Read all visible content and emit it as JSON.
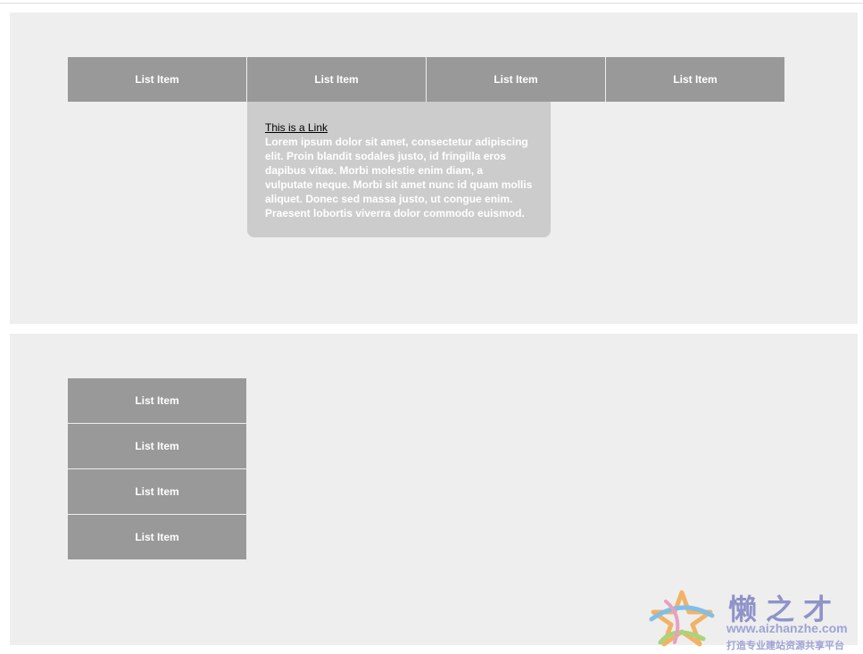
{
  "horizontal_menu": {
    "items": [
      {
        "label": "List Item"
      },
      {
        "label": "List Item"
      },
      {
        "label": "List Item"
      },
      {
        "label": "List Item"
      }
    ],
    "dropdown": {
      "link_text": "This is a Link",
      "body_text": "Lorem ipsum dolor sit amet, consectetur adipiscing elit. Proin blandit sodales justo, id fringilla eros dapibus vitae. Morbi molestie enim diam, a vulputate neque. Morbi sit amet nunc id quam mollis aliquet. Donec sed massa justo, ut congue enim. Praesent lobortis viverra dolor commodo euismod."
    }
  },
  "vertical_menu": {
    "items": [
      {
        "label": "List Item"
      },
      {
        "label": "List Item"
      },
      {
        "label": "List Item"
      },
      {
        "label": "List Item"
      }
    ]
  },
  "watermark": {
    "title": "懒之才",
    "url": "www.aizhanzhe.com",
    "slogan": "打造专业建站资源共享平台",
    "logo_icon": "star-swirl-logo-icon"
  },
  "colors": {
    "panel_bg": "#eeeeee",
    "menu_item_bg": "#999999",
    "dropdown_bg": "#cccccc",
    "menu_text": "#ffffff",
    "watermark_text": "#8f93c9"
  }
}
